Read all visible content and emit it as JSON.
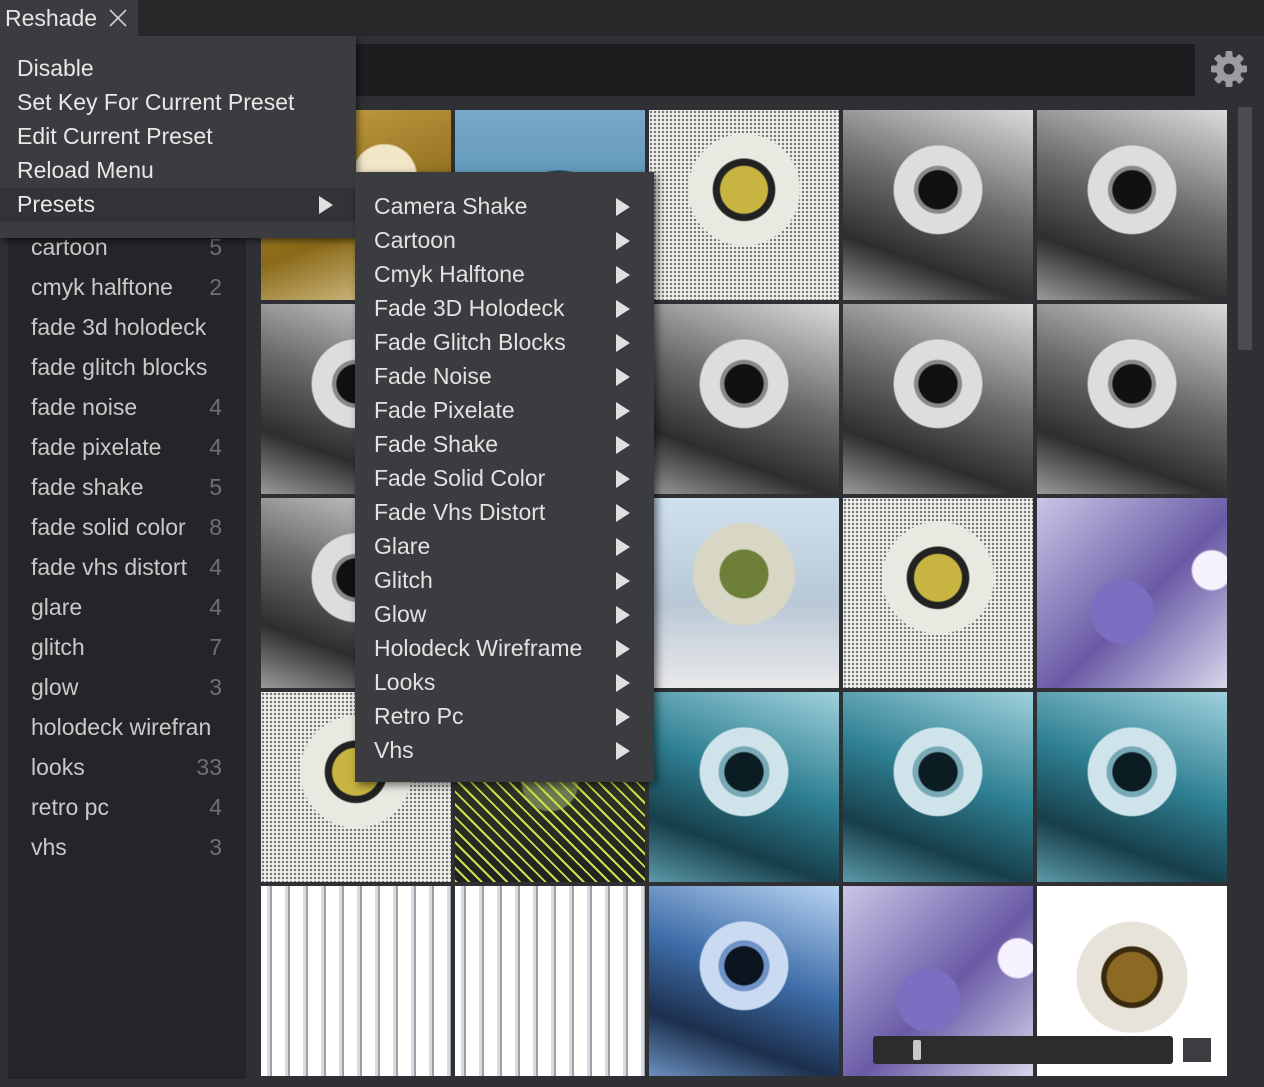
{
  "tab": {
    "title": "Reshade",
    "close_icon": "close-icon"
  },
  "sidebar": {
    "items": [
      {
        "label": "cartoon",
        "count": "5"
      },
      {
        "label": "cmyk halftone",
        "count": "2"
      },
      {
        "label": "fade 3d holodeck",
        "count": ""
      },
      {
        "label": "fade glitch blocks",
        "count": ""
      },
      {
        "label": "fade noise",
        "count": "4"
      },
      {
        "label": "fade pixelate",
        "count": "4"
      },
      {
        "label": "fade shake",
        "count": "5"
      },
      {
        "label": "fade solid color",
        "count": "8"
      },
      {
        "label": "fade vhs distort",
        "count": "4"
      },
      {
        "label": "glare",
        "count": "4"
      },
      {
        "label": "glitch",
        "count": "7"
      },
      {
        "label": "glow",
        "count": "3"
      },
      {
        "label": "holodeck wirefran",
        "count": ""
      },
      {
        "label": "looks",
        "count": "33"
      },
      {
        "label": "retro pc",
        "count": "4"
      },
      {
        "label": "vhs",
        "count": "3"
      }
    ]
  },
  "settings_icon": "gear-icon",
  "context_menu": {
    "items": [
      {
        "label": "Disable"
      },
      {
        "label": "Set Key For Current Preset"
      },
      {
        "label": "Edit Current Preset"
      },
      {
        "label": "Reload Menu"
      },
      {
        "label": "Presets",
        "has_submenu": true
      }
    ]
  },
  "presets_menu": {
    "items": [
      {
        "label": "Camera Shake"
      },
      {
        "label": "Cartoon"
      },
      {
        "label": "Cmyk Halftone"
      },
      {
        "label": "Fade 3D Holodeck"
      },
      {
        "label": "Fade Glitch Blocks"
      },
      {
        "label": "Fade Noise"
      },
      {
        "label": "Fade Pixelate"
      },
      {
        "label": "Fade Shake"
      },
      {
        "label": "Fade Solid Color"
      },
      {
        "label": "Fade Vhs Distort"
      },
      {
        "label": "Glare"
      },
      {
        "label": "Glitch"
      },
      {
        "label": "Glow"
      },
      {
        "label": "Holodeck Wireframe"
      },
      {
        "label": "Looks"
      },
      {
        "label": "Retro Pc"
      },
      {
        "label": "Vhs"
      }
    ]
  },
  "thumbnail_styles": [
    "yellow",
    "cyan",
    "halftone",
    "gray",
    "gray",
    "gray",
    "gray",
    "gray",
    "gray",
    "gray",
    "gray",
    "gray",
    "color",
    "halftone",
    "purple",
    "halftone",
    "wireframe",
    "teal",
    "teal",
    "teal",
    "glitch",
    "glitch",
    "blue",
    "purple",
    "gold"
  ]
}
